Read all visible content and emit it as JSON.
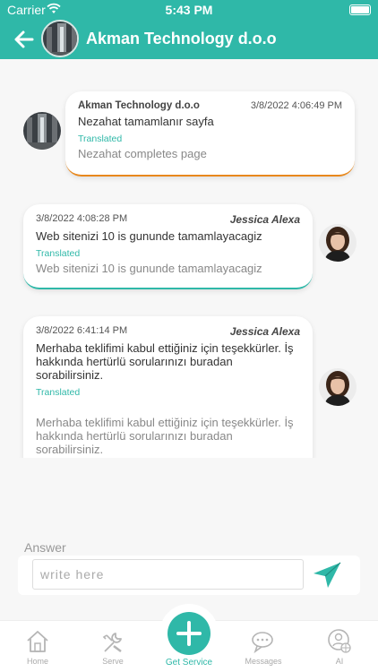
{
  "status_bar": {
    "carrier": "Carrier",
    "time": "5:43 PM"
  },
  "header": {
    "title": "Akman Technology d.o.o",
    "back_icon": "arrow-left-icon"
  },
  "messages": [
    {
      "sender": "Akman Technology d.o.o",
      "timestamp": "3/8/2022 4:06:49 PM",
      "text": "Nezahat tamamlanır sayfa",
      "translated_label": "Translated",
      "translated_text": "Nezahat completes page"
    },
    {
      "sender": "Jessica Alexa",
      "timestamp": "3/8/2022 4:08:28 PM",
      "text": "Web sitenizi 10 is gununde tamamlayacagiz",
      "translated_label": "Translated",
      "translated_text": "Web sitenizi 10 is gununde tamamlayacagiz"
    },
    {
      "sender": "Jessica Alexa",
      "timestamp": "3/8/2022 6:41:14 PM",
      "text": " Merhaba teklifimi kabul ettiğiniz için teşekkürler. İş hakkında hertürlü sorularınızı buradan sorabilirsiniz.",
      "translated_label": "Translated",
      "translated_text": " Merhaba teklifimi kabul ettiğiniz için teşekkürler. İş hakkında hertürlü sorularınızı buradan sorabilirsiniz."
    }
  ],
  "answer": {
    "label": "Answer",
    "placeholder": "write here",
    "send_icon": "send-icon"
  },
  "tabs": [
    {
      "label": "Home",
      "icon": "home-icon"
    },
    {
      "label": "Serve",
      "icon": "serve-icon"
    },
    {
      "label": "Get Service",
      "icon": "plus-icon"
    },
    {
      "label": "Messages",
      "icon": "messages-icon"
    },
    {
      "label": "AI",
      "icon": "ai-globe-icon"
    }
  ],
  "colors": {
    "primary": "#2fb8a8",
    "accent_orange": "#e8881d",
    "background": "#f7f7f7"
  }
}
